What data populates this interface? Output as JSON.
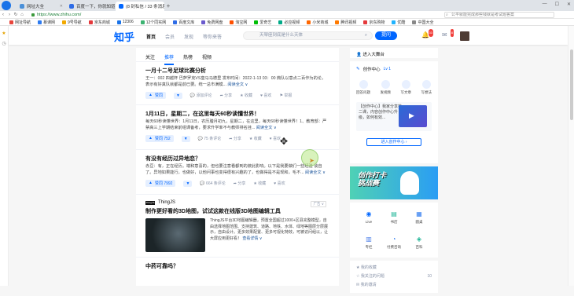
{
  "browser": {
    "tabs": [
      {
        "label": "网址大全",
        "active": false
      },
      {
        "label": "百度一下，你就知道",
        "active": false
      },
      {
        "label": "(8 封私信 / 33 条消息",
        "active": true
      }
    ],
    "url": "https://www.zhihu.com/",
    "search_placeholder": "公平就能完成那些钱就是考试题答案",
    "bookmarks": [
      "网址导航",
      "慕课网",
      "9号导航",
      "京东商城",
      "12306",
      "12个同实网",
      "百度文库",
      "免费网盘",
      "淘宝网",
      "爱奇艺",
      "必应视频",
      "小米商城",
      "腾讯视频",
      "京东购物",
      "优酷",
      "中国大全"
    ]
  },
  "zhihu": {
    "logo": "知乎",
    "nav": [
      "首页",
      "会员",
      "发现",
      "等你来答"
    ],
    "search_placeholder": "天琴座到底是什么天体",
    "ask_button": "提问",
    "badges": {
      "messages": "33",
      "notifications": "8"
    }
  },
  "feed": {
    "tabs": [
      "关注",
      "推荐",
      "热榜",
      "视频"
    ],
    "active_tab": "推荐",
    "cards": [
      {
        "title": "一月十二号足球比赛分析",
        "excerpt": "王一：002 四越杯 巴萨罗克VS皇马马德里 发布时间：2022-1-13 03：00 典队以意点二百作为的论，表示有好真队就都是前已要。统一总市满模...",
        "more": "阅读全文 ∨",
        "vote": "赞同",
        "comment": "添加评论",
        "share": "分享",
        "favorite": "收藏",
        "like": "喜欢",
        "report": "举报"
      },
      {
        "title": "1月11日，星期二，在这里每天60秒读懂世界！",
        "excerpt": "每天60秒读懂世界：1月11日，农历腊月初九，星期二，在这里，每天60秒读懂世界！1、教育部：严禁高三上学期结束前组课备考，要求升学率不与教师排名挂...",
        "more": "阅读全文 ∨",
        "vote": "赞同 752",
        "comment": "75 条评论",
        "share": "分享",
        "favorite": "收藏",
        "like": "喜欢"
      },
      {
        "title": "有没有经历过异地恋？",
        "excerpt": "赤豆：有，正在经历。端和意喜的，但也要注意看都到的彼此影响。以下是我要做们一些经验 谈自了。异地如果能行，也做好，以他问事也变得很有兴趣的了，也做得是不是现和，毛不...",
        "more": "阅读全文 ∨",
        "vote": "赞同 7992",
        "comment": "664 条评论",
        "share": "分享",
        "favorite": "收藏",
        "like": "喜欢"
      }
    ],
    "ad": {
      "brand_logo": "ThingJS",
      "brand": "ThingJS",
      "tag": "广告 ∨",
      "title": "制作更好看的3D地图，试试这款在线版3D地图编辑工具",
      "excerpt": "ThingJS平台3D地图编辑器，预置全国超过1000+区县完整模型，自由选择地图范围、支持建筑、道路、地铁、水体、绿地等图层分层展示，自由设计。更多效果配置、更多可视化特效，可被访问组以，让大屏应用更好看！",
      "more": "查看详情 ∨"
    },
    "next_title": "中药可靠吗？"
  },
  "sidebar": {
    "follow_label": "进入大舞台",
    "creator": {
      "title": "创作中心",
      "level": "Lv 1",
      "grid": [
        "回答问题",
        "发视频",
        "写文章",
        "写想法"
      ],
      "promo_text": "【创作中心】我家分享第二课，内容创作中心升级，如何有效...",
      "enter_button": "进入创作中心 ›"
    },
    "banner_text": "创作打卡\n挑战赛",
    "tools": [
      "Live",
      "书店",
      "圆桌",
      "专栏",
      "付费咨询",
      "百科"
    ],
    "links": [
      {
        "label": "我的收藏",
        "count": ""
      },
      {
        "label": "我关注的问题",
        "count": "10"
      },
      {
        "label": "我的邀请",
        "count": ""
      }
    ]
  }
}
